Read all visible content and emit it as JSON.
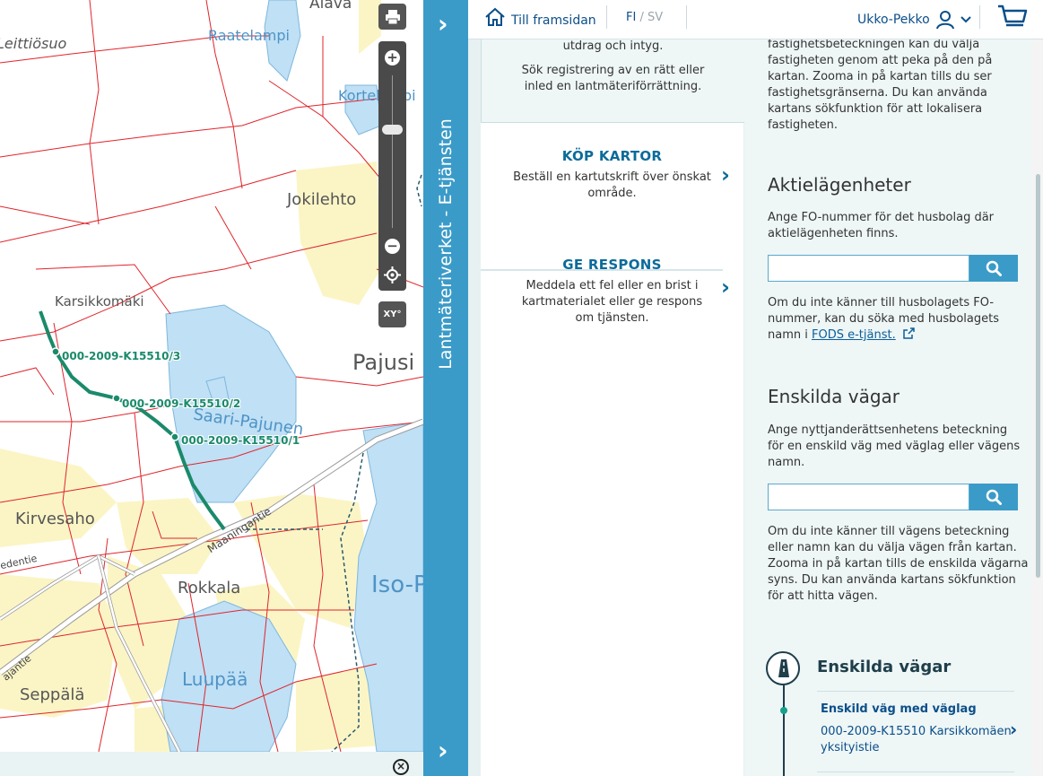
{
  "header": {
    "home_label": "Till framsidan",
    "lang_fi": "FI",
    "lang_sep": "/",
    "lang_sv": "SV",
    "user_name": "Ukko-Pekko"
  },
  "sidebar": {
    "title": "Lantmäteriverket - E-tjänsten"
  },
  "map": {
    "places": [
      {
        "name": "Alava"
      },
      {
        "name": "Raatelampi"
      },
      {
        "name": "Leittiösuo"
      },
      {
        "name": "Kortelampi"
      },
      {
        "name": "Jokilehto"
      },
      {
        "name": "Karsikkomäki"
      },
      {
        "name": "Pajusi"
      },
      {
        "name": "Saari-Pajunen"
      },
      {
        "name": "Kirvesaho"
      },
      {
        "name": "Rokkala"
      },
      {
        "name": "Iso-P"
      },
      {
        "name": "Luupää"
      },
      {
        "name": "Seppälä"
      }
    ],
    "roads": [
      {
        "name": "Maaningantie"
      },
      {
        "name": "edentie"
      },
      {
        "name": "ajantie"
      }
    ],
    "route_labels": [
      {
        "text": "000-2009-K15510/3"
      },
      {
        "text": "000-2009-K15510/2"
      },
      {
        "text": "000-2009-K15510/1"
      }
    ],
    "controls": {
      "print": "print-icon",
      "zoom_in": "+",
      "zoom_out": "−",
      "zoom_level_fraction": 0.35,
      "locate": "locate-icon",
      "coords": "XY°"
    },
    "colors": {
      "boundary": "#e0242b",
      "water": "#bfe0f5",
      "field": "#fbf5c6",
      "route": "#1a8a6a"
    }
  },
  "middle": {
    "top_lines": [
      "utdrag och intyg.",
      "Sök registrering av en rätt eller",
      "inled en lantmäteriförrättning."
    ],
    "cards": [
      {
        "title": "KÖP KARTOR",
        "desc": [
          "Beställ en kartutskrift över önskat",
          "område."
        ]
      },
      {
        "title": "GE RESPONS",
        "desc": [
          "Meddela ett fel eller en brist i",
          "kartmaterialet eller ge respons",
          "om tjänsten."
        ]
      }
    ]
  },
  "right": {
    "intro_lines": [
      "fastighetsbeteckningen kan du välja",
      "fastigheten genom att peka på den på",
      "kartan. Zooma in på kartan tills du ser",
      "fastighetsgränserna. Du kan använda",
      "kartans sökfunktion för att lokalisera",
      "fastigheten."
    ],
    "aktie": {
      "title": "Aktielägenheter",
      "desc": [
        "Ange FO-nummer för det husbolag där",
        "aktielägenheten finns."
      ],
      "input_value": "",
      "help_lines": [
        "Om du inte känner till husbolagets FO-",
        "nummer, kan du söka med husbolagets"
      ],
      "help_prefix": "namn i ",
      "help_link": "FODS e-tjänst."
    },
    "vagar": {
      "title": "Enskilda vägar",
      "desc": [
        "Ange nyttjanderättsenhetens beteckning",
        "för en enskild väg med väglag eller vägens",
        "namn."
      ],
      "input_value": "",
      "help_lines": [
        "Om du inte känner till vägens beteckning",
        "eller namn kan du välja vägen från kartan.",
        "Zooma in på kartan tills de enskilda vägarna",
        "syns. Du kan använda kartans sökfunktion",
        "för att hitta vägen."
      ]
    },
    "road_result": {
      "title": "Enskilda vägar",
      "subtitle": "Enskild väg med väglag",
      "value": "000-2009-K15510 Karsikkomäen yksityistie"
    }
  }
}
